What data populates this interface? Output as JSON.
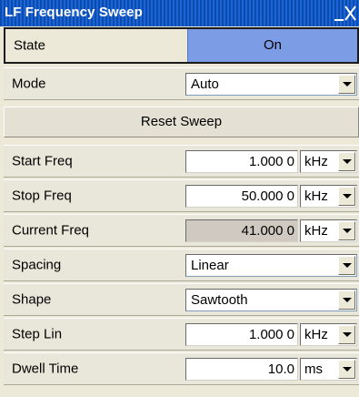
{
  "window": {
    "title": "LF Frequency Sweep",
    "close_icon": "minimize-close-icon"
  },
  "state": {
    "label": "State",
    "value": "On"
  },
  "mode": {
    "label": "Mode",
    "value": "Auto"
  },
  "reset": {
    "label": "Reset Sweep"
  },
  "start_freq": {
    "label": "Start Freq",
    "value": "1.000 0",
    "unit": "kHz"
  },
  "stop_freq": {
    "label": "Stop Freq",
    "value": "50.000 0",
    "unit": "kHz"
  },
  "current_freq": {
    "label": "Current Freq",
    "value": "41.000 0",
    "unit": "kHz"
  },
  "spacing": {
    "label": "Spacing",
    "value": "Linear"
  },
  "shape": {
    "label": "Shape",
    "value": "Sawtooth"
  },
  "step_lin": {
    "label": "Step Lin",
    "value": "1.000 0",
    "unit": "kHz"
  },
  "dwell_time": {
    "label": "Dwell Time",
    "value": "10.0",
    "unit": "ms"
  },
  "colors": {
    "title_bar": "#1d64d4",
    "state_on": "#7c9de6",
    "panel": "#ece9d8",
    "readonly_field": "#cfc9c1"
  }
}
